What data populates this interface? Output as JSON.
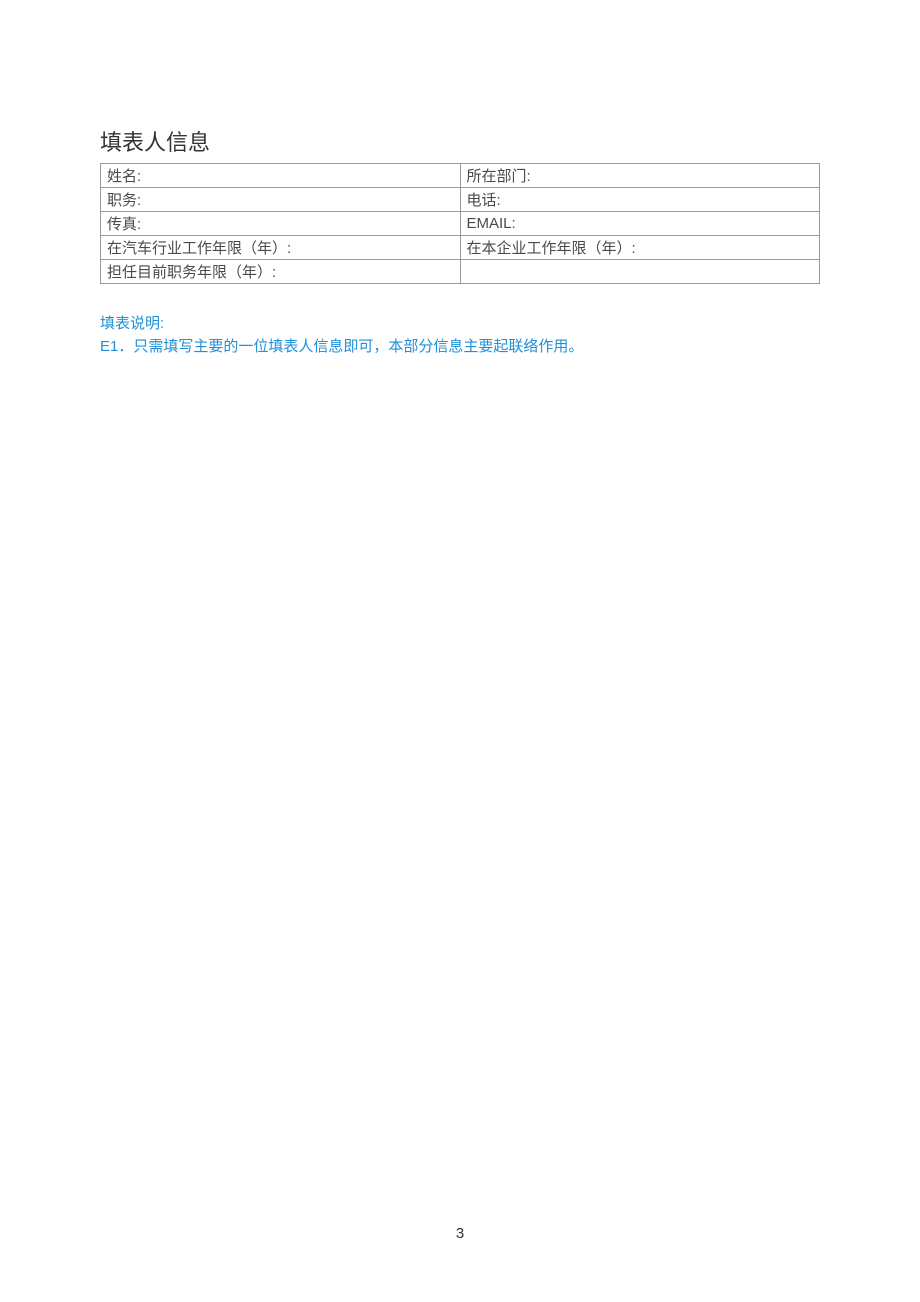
{
  "section_title": "填表人信息",
  "table": {
    "rows": [
      {
        "left": "姓名:",
        "right": "所在部门:"
      },
      {
        "left": "职务:",
        "right": "电话:"
      },
      {
        "left": "传真:",
        "right": "EMAIL:"
      },
      {
        "left": "在汽车行业工作年限（年）:",
        "right": "在本企业工作年限（年）:"
      },
      {
        "left": "担任目前职务年限（年）:",
        "right": ""
      }
    ]
  },
  "instructions": {
    "header": "填表说明:",
    "line1": "E1．只需填写主要的一位填表人信息即可，本部分信息主要起联络作用。"
  },
  "page_number": "3"
}
